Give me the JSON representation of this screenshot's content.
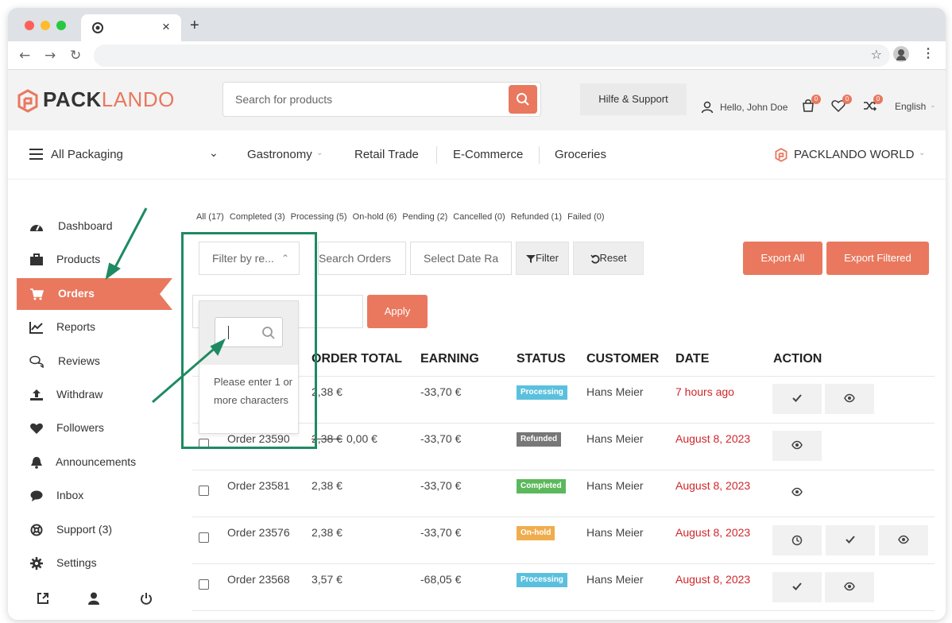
{
  "browser": {
    "tab_close": "×",
    "new_tab": "+"
  },
  "header": {
    "logo_part1": "PACK",
    "logo_part2": "LANDO",
    "search_placeholder": "Search for products",
    "help_label": "Hilfe & Support",
    "greeting": "Hello, John Doe",
    "cart_count": "0",
    "wishlist_count": "0",
    "compare_count": "0",
    "language": "English"
  },
  "categories": {
    "all": "All Packaging",
    "gastronomy": "Gastronomy",
    "retail": "Retail Trade",
    "ecommerce": "E-Commerce",
    "groceries": "Groceries",
    "world": "PACKLANDO WORLD"
  },
  "sidebar": {
    "items": [
      {
        "label": "Dashboard"
      },
      {
        "label": "Products"
      },
      {
        "label": "Orders"
      },
      {
        "label": "Reports"
      },
      {
        "label": "Reviews"
      },
      {
        "label": "Withdraw"
      },
      {
        "label": "Followers"
      },
      {
        "label": "Announcements"
      },
      {
        "label": "Inbox"
      },
      {
        "label": "Support (3)"
      },
      {
        "label": "Settings"
      }
    ]
  },
  "status_filters": [
    "All (17)",
    "Completed (3)",
    "Processing (5)",
    "On-hold (6)",
    "Pending (2)",
    "Cancelled (0)",
    "Refunded (1)",
    "Failed (0)"
  ],
  "toolbar": {
    "filter_select": "Filter by re...",
    "search_orders": "Search Orders",
    "date_range": "Select Date Ra",
    "filter": "Filter",
    "reset": "Reset",
    "export_all": "Export All",
    "export_filtered": "Export Filtered",
    "apply": "Apply"
  },
  "dropdown": {
    "message": "Please enter 1 or more characters"
  },
  "table": {
    "headers": [
      "ORDER TOTAL",
      "EARNING",
      "STATUS",
      "CUSTOMER",
      "DATE",
      "ACTION"
    ],
    "rows": [
      {
        "order": "",
        "total": "2,38 €",
        "old_total": "",
        "earning": "-33,70 €",
        "status": "Processing",
        "customer": "Hans Meier",
        "date": "7 hours ago"
      },
      {
        "order": "Order 23590",
        "total": "0,00 €",
        "old_total": "2,38 €",
        "earning": "-33,70 €",
        "status": "Refunded",
        "customer": "Hans Meier",
        "date": "August 8, 2023"
      },
      {
        "order": "Order 23581",
        "total": "2,38 €",
        "old_total": "",
        "earning": "-33,70 €",
        "status": "Completed",
        "customer": "Hans Meier",
        "date": "August 8, 2023"
      },
      {
        "order": "Order 23576",
        "total": "2,38 €",
        "old_total": "",
        "earning": "-33,70 €",
        "status": "On-hold",
        "customer": "Hans Meier",
        "date": "August 8, 2023"
      },
      {
        "order": "Order 23568",
        "total": "3,57 €",
        "old_total": "",
        "earning": "-68,05 €",
        "status": "Processing",
        "customer": "Hans Meier",
        "date": "August 8, 2023"
      }
    ]
  },
  "colors": {
    "brand": "#e9785f",
    "processing": "#5bc0de",
    "refunded": "#777777",
    "completed": "#5cb85c",
    "on_hold": "#f0ad4e",
    "date_red": "#d0262b",
    "annotation": "#1e8a62"
  }
}
